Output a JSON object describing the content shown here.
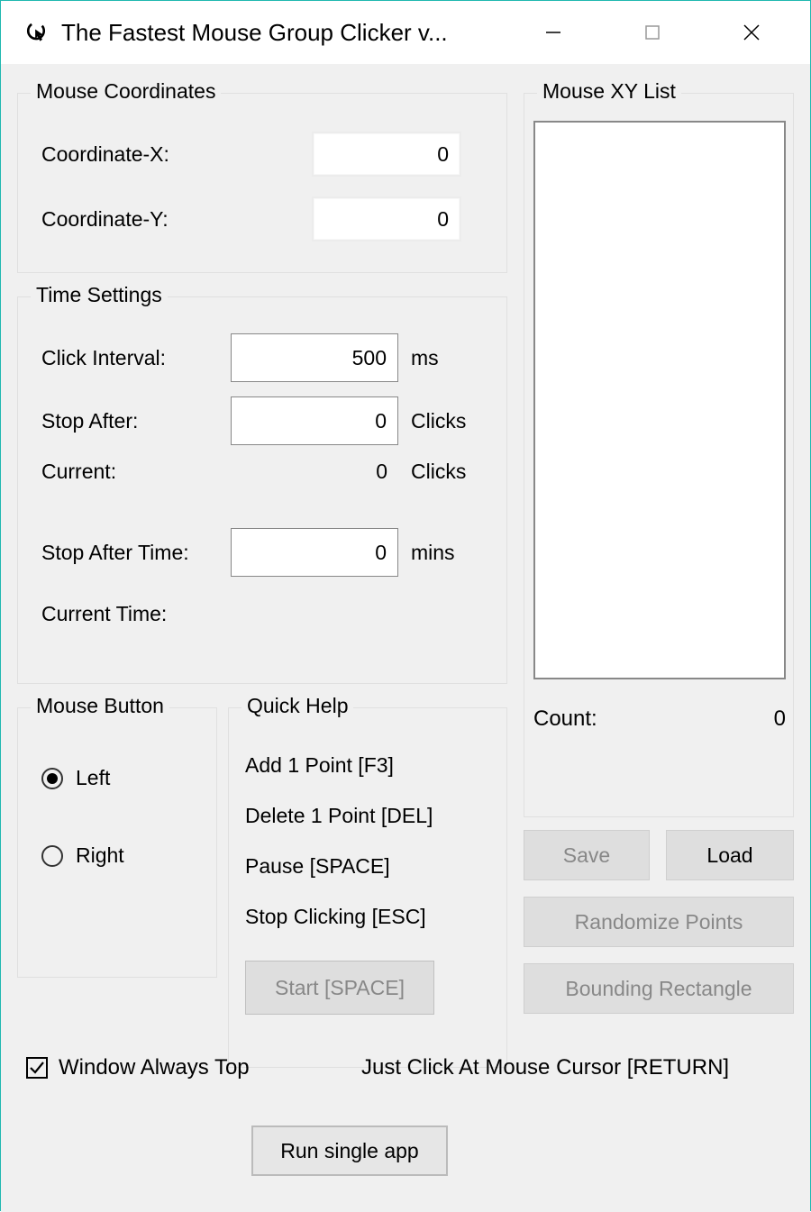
{
  "window": {
    "title": "The Fastest Mouse Group Clicker v..."
  },
  "coords": {
    "legend": "Mouse Coordinates",
    "x_label": "Coordinate-X:",
    "x_value": "0",
    "y_label": "Coordinate-Y:",
    "y_value": "0"
  },
  "time": {
    "legend": "Time Settings",
    "interval_label": "Click Interval:",
    "interval_value": "500",
    "interval_unit": "ms",
    "stop_after_label": "Stop After:",
    "stop_after_value": "0",
    "stop_after_unit": "Clicks",
    "current_label": "Current:",
    "current_value": "0",
    "current_unit": "Clicks",
    "stop_time_label": "Stop After Time:",
    "stop_time_value": "0",
    "stop_time_unit": "mins",
    "current_time_label": "Current Time:",
    "current_time_value": ""
  },
  "mouse_button": {
    "legend": "Mouse Button",
    "left": "Left",
    "right": "Right",
    "selected": "left"
  },
  "quick_help": {
    "legend": "Quick Help",
    "items": [
      "Add 1 Point [F3]",
      "Delete 1 Point [DEL]",
      "Pause [SPACE]",
      "Stop Clicking [ESC]"
    ],
    "start_button": "Start [SPACE]"
  },
  "xy_list": {
    "legend": "Mouse XY List",
    "items": [],
    "count_label": "Count:",
    "count_value": "0"
  },
  "buttons": {
    "save": "Save",
    "load": "Load",
    "randomize": "Randomize Points",
    "bounding": "Bounding Rectangle",
    "run_single": "Run single app"
  },
  "footer": {
    "always_top": "Window Always Top",
    "always_top_checked": true,
    "just_click": "Just Click At Mouse Cursor [RETURN]"
  }
}
